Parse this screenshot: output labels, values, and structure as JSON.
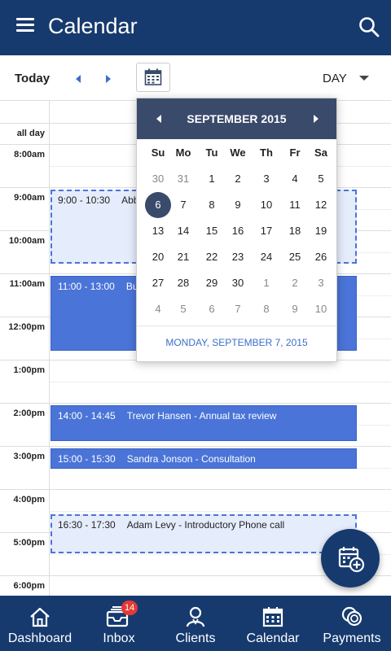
{
  "header": {
    "title": "Calendar"
  },
  "toolbar": {
    "today_label": "Today",
    "view_label": "DAY"
  },
  "grid": {
    "allday_label": "all day",
    "time_labels": [
      "8:00am",
      "9:00am",
      "10:00am",
      "11:00am",
      "12:00pm",
      "1:00pm",
      "2:00pm",
      "3:00pm",
      "4:00pm",
      "5:00pm",
      "6:00pm"
    ]
  },
  "events": [
    {
      "time": "9:00 - 10:30",
      "title": "Abb"
    },
    {
      "time": "11:00 - 13:00",
      "title": "Bu"
    },
    {
      "time": "14:00 - 14:45",
      "title": "Trevor Hansen - Annual tax review"
    },
    {
      "time": "15:00 - 15:30",
      "title": "Sandra Jonson - Consultation"
    },
    {
      "time": "16:30 - 17:30",
      "title": "Adam Levy - Introductory Phone call"
    }
  ],
  "datepicker": {
    "month_label": "SEPTEMBER 2015",
    "weekdays": [
      "Su",
      "Mo",
      "Tu",
      "We",
      "Th",
      "Fr",
      "Sa"
    ],
    "weeks": [
      [
        "30",
        "31",
        "1",
        "2",
        "3",
        "4",
        "5"
      ],
      [
        "6",
        "7",
        "8",
        "9",
        "10",
        "11",
        "12"
      ],
      [
        "13",
        "14",
        "15",
        "16",
        "17",
        "18",
        "19"
      ],
      [
        "20",
        "21",
        "22",
        "23",
        "24",
        "25",
        "26"
      ],
      [
        "27",
        "28",
        "29",
        "30",
        "1",
        "2",
        "3"
      ],
      [
        "4",
        "5",
        "6",
        "7",
        "8",
        "9",
        "10"
      ]
    ],
    "selected_date_label": "MONDAY, SEPTEMBER 7, 2015"
  },
  "bottom_nav": {
    "items": [
      {
        "label": "Dashboard",
        "icon": "home-icon"
      },
      {
        "label": "Inbox",
        "icon": "inbox-icon",
        "badge": "14"
      },
      {
        "label": "Clients",
        "icon": "clients-icon"
      },
      {
        "label": "Calendar",
        "icon": "calendar-icon"
      },
      {
        "label": "Payments",
        "icon": "payments-icon"
      }
    ]
  },
  "colors": {
    "primary": "#163a6e",
    "event": "#4a74d8",
    "picker_header": "#3a4a6b",
    "badge": "#e53935"
  }
}
